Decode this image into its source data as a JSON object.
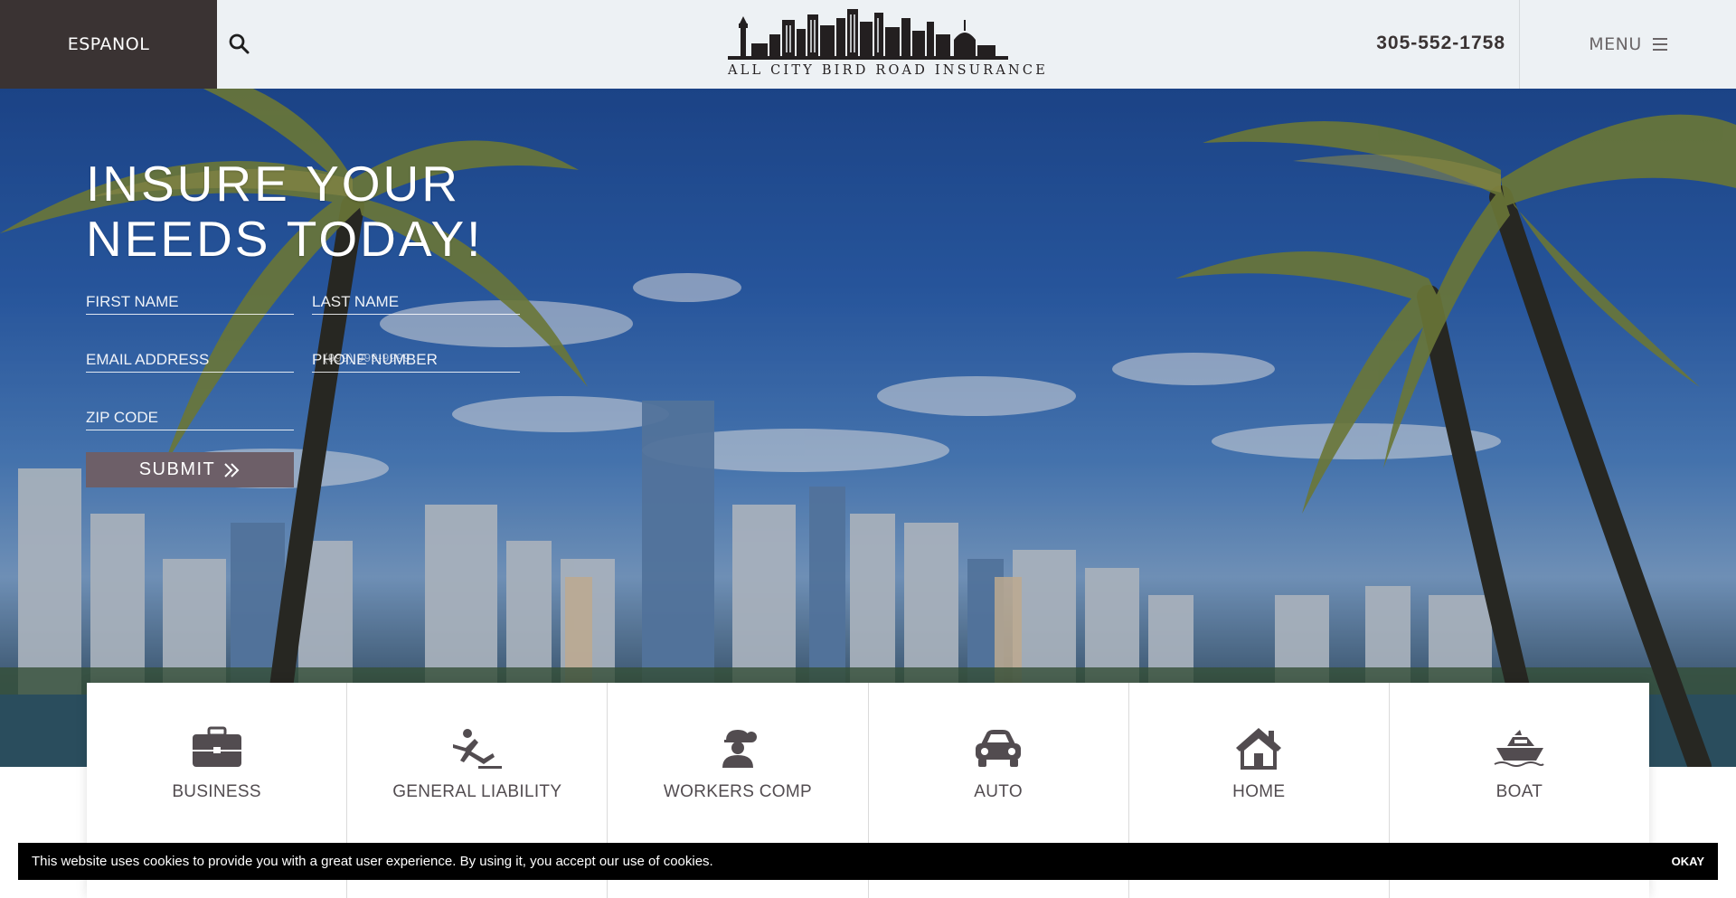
{
  "header": {
    "language_button": "ESPANOL",
    "search_icon": "search-icon",
    "logo_text": "ALL CITY BIRD ROAD INSURANCE",
    "phone": "305-552-1758",
    "menu_label": "MENU",
    "menu_icon": "hamburger-icon"
  },
  "hero": {
    "title_line1": "INSURE YOUR",
    "title_line2": "NEEDS TODAY!",
    "form": {
      "first_name_placeholder": "FIRST NAME",
      "last_name_placeholder": "LAST NAME",
      "email_placeholder": "EMAIL ADDRESS",
      "phone_placeholder": "PHONE NUMBER",
      "phone_mask": "(999) 999-9999",
      "zip_placeholder": "ZIP CODE",
      "submit_label": "SUBMIT"
    }
  },
  "services": [
    {
      "label": "BUSINESS",
      "icon": "briefcase-icon"
    },
    {
      "label": "GENERAL LIABILITY",
      "icon": "slip-fall-icon"
    },
    {
      "label": "WORKERS COMP",
      "icon": "worker-icon"
    },
    {
      "label": "AUTO",
      "icon": "car-icon"
    },
    {
      "label": "HOME",
      "icon": "house-icon"
    },
    {
      "label": "BOAT",
      "icon": "boat-icon"
    }
  ],
  "cookie_bar": {
    "message": "This website uses cookies to provide you with a great user experience. By using it, you accept our use of cookies.",
    "button_label": "OKAY"
  },
  "colors": {
    "header_bg": "#edf1f4",
    "language_bg": "#3a3333",
    "submit_bg": "#6d5f68",
    "icon_color": "#524c50",
    "cookie_bg": "#000000"
  }
}
